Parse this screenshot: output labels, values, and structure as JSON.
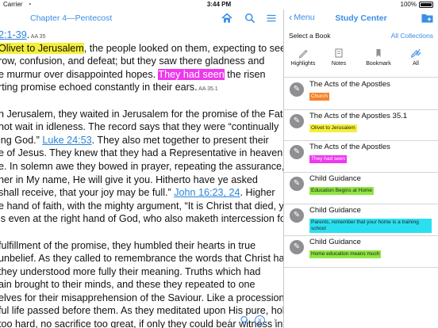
{
  "status_bar": {
    "carrier": "Carrier",
    "time": "3:44 PM",
    "battery": "100%"
  },
  "reader": {
    "chapter_title": "Chapter 4—Pentecost",
    "icons": {
      "home": "home-icon",
      "search": "search-icon",
      "menu": "menu-icon"
    },
    "lines": [
      [
        {
          "t": "2:1-39",
          "s": "ref"
        },
        {
          "t": ".",
          "s": ""
        },
        {
          "t": " AA 35",
          "s": "small"
        }
      ],
      [
        {
          "t": " Olivet to Jerusalem",
          "s": "yellow"
        },
        {
          "t": ", the people looked on them, expecting to see",
          "s": ""
        }
      ],
      [
        {
          "t": "row, confusion, and defeat; but they saw there gladness and",
          "s": ""
        }
      ],
      [
        {
          "t": "e murmur over disappointed hopes. ",
          "s": ""
        },
        {
          "t": "They had seen",
          "s": "magenta"
        },
        {
          "t": " the risen",
          "s": ""
        }
      ],
      [
        {
          "t": "rting promise echoed constantly in their ears.",
          "s": ""
        },
        {
          "t": " AA 35.1",
          "s": "small"
        }
      ],
      [
        {
          "t": "",
          "s": ""
        }
      ],
      [
        {
          "t": "n Jerusalem, they waited in Jerusalem for the promise of the Father—the",
          "s": ""
        }
      ],
      [
        {
          "t": "not wait in idleness. The record says that they were “continually",
          "s": ""
        }
      ],
      [
        {
          "t": "ing God.” ",
          "s": ""
        },
        {
          "t": "Luke 24:53",
          "s": "ref"
        },
        {
          "t": ". They also met together to present their",
          "s": ""
        }
      ],
      [
        {
          "t": "e of Jesus. They knew that they had a Representative in heaven,",
          "s": ""
        }
      ],
      [
        {
          "t": "e. In solemn awe they bowed in prayer, repeating the assurance,",
          "s": ""
        }
      ],
      [
        {
          "t": "her in My name, He will give it you. Hitherto have ye asked",
          "s": ""
        }
      ],
      [
        {
          "t": "shall receive, that your joy may be full.” ",
          "s": ""
        },
        {
          "t": "John 16:23, 24",
          "s": "ref"
        },
        {
          "t": ". Higher",
          "s": ""
        }
      ],
      [
        {
          "t": "e hand of faith, with the mighty argument, “It is Christ that died, yea",
          "s": ""
        }
      ],
      [
        {
          "t": "is even at the right hand of God, who also maketh intercession for",
          "s": ""
        }
      ],
      [
        {
          "t": "",
          "s": ""
        }
      ],
      [
        {
          "t": "fulfillment of the promise, they humbled their hearts in true",
          "s": ""
        }
      ],
      [
        {
          "t": "unbelief. As they called to remembrance the words that Christ had",
          "s": ""
        }
      ],
      [
        {
          "t": " they understood more fully their meaning. Truths which had",
          "s": ""
        }
      ],
      [
        {
          "t": "ain brought to their minds, and these they repeated to one",
          "s": ""
        }
      ],
      [
        {
          "t": "elves for their misapprehension of the Saviour. Like a procession,",
          "s": ""
        }
      ],
      [
        {
          "t": "ful life passed before them. As they meditated upon His pure, holy",
          "s": ""
        }
      ],
      [
        {
          "t": "too hard, no sacrifice too great, if only they could bear witness in",
          "s": ""
        }
      ]
    ]
  },
  "study": {
    "back_label": "Menu",
    "title": "Study Center",
    "select_book_label": "Select a Book",
    "all_collections_label": "All Collections",
    "filters": [
      {
        "label": "Highlights",
        "icon": "pencil-icon"
      },
      {
        "label": "Notes",
        "icon": "note-icon"
      },
      {
        "label": "Bookmark",
        "icon": "bookmark-icon"
      },
      {
        "label": "All",
        "icon": "all-icon"
      }
    ],
    "items": [
      {
        "title": "The Acts of the Apostles",
        "tag": "Church",
        "tag_color": "#f5842a"
      },
      {
        "title": "The Acts of the Apostles 35.1",
        "tag": "Olivet to Jerusalem",
        "tag_color": "#f5ef3a"
      },
      {
        "title": "The Acts of the Apostles",
        "tag": "They had seen",
        "tag_color": "#ee37ee"
      },
      {
        "title": "Child Guidance",
        "tag": "Education Begins at Home",
        "tag_color": "#8ee641"
      },
      {
        "title": "Child Guidance",
        "tag": "Parents, remember that your home is a training school",
        "tag_color": "#2ae0f0"
      },
      {
        "title": "Child Guidance",
        "tag": "Home education means much",
        "tag_color": "#8ee641"
      }
    ]
  },
  "colors": {
    "accent": "#3a8ee6",
    "highlight_yellow": "#f5ef3a",
    "highlight_magenta": "#ee37ee"
  }
}
